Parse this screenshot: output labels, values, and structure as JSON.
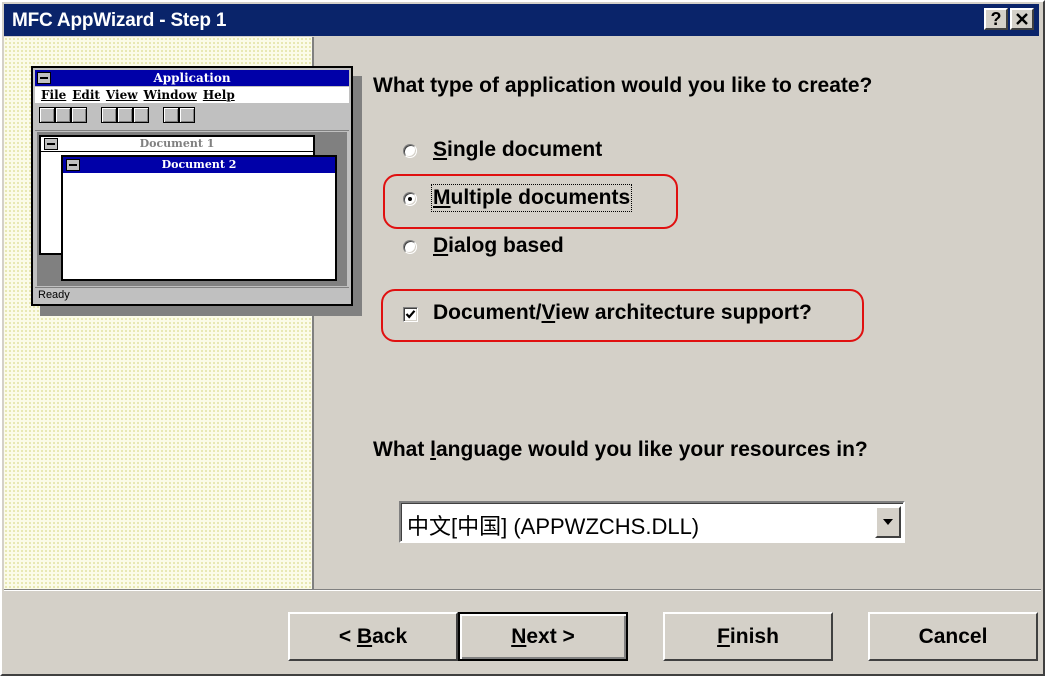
{
  "window": {
    "title": "MFC AppWizard - Step 1",
    "help_button": "?",
    "close_button": "✕"
  },
  "illustration": {
    "app_title": "Application",
    "menu": [
      "File",
      "Edit",
      "View",
      "Window",
      "Help"
    ],
    "doc1_title": "Document 1",
    "doc2_title": "Document 2",
    "status": "Ready"
  },
  "question_app_type": "What type of application would you like to create?",
  "options": {
    "single": {
      "first": "S",
      "rest": "ingle document",
      "selected": false
    },
    "multiple": {
      "first": "M",
      "rest": "ultiple documents",
      "selected": true
    },
    "dialog": {
      "first": "D",
      "rest": "ialog based",
      "selected": false
    }
  },
  "docview": {
    "before": "Document/",
    "underlined": "V",
    "after": "iew architecture support?",
    "checked": true
  },
  "question_language": {
    "before": "What ",
    "underlined": "l",
    "after": "anguage would you like your resources in?"
  },
  "language_select": {
    "value": "中文[中国] (APPWZCHS.DLL)"
  },
  "buttons": {
    "back": {
      "prefix": "< ",
      "underlined": "B",
      "rest": "ack"
    },
    "next": {
      "underlined": "N",
      "rest": "ext >"
    },
    "finish": {
      "underlined": "F",
      "rest": "inish"
    },
    "cancel": "Cancel"
  },
  "colors": {
    "title_bar": "#0a246a",
    "highlight": "#e01010",
    "face": "#d4d0c8"
  }
}
